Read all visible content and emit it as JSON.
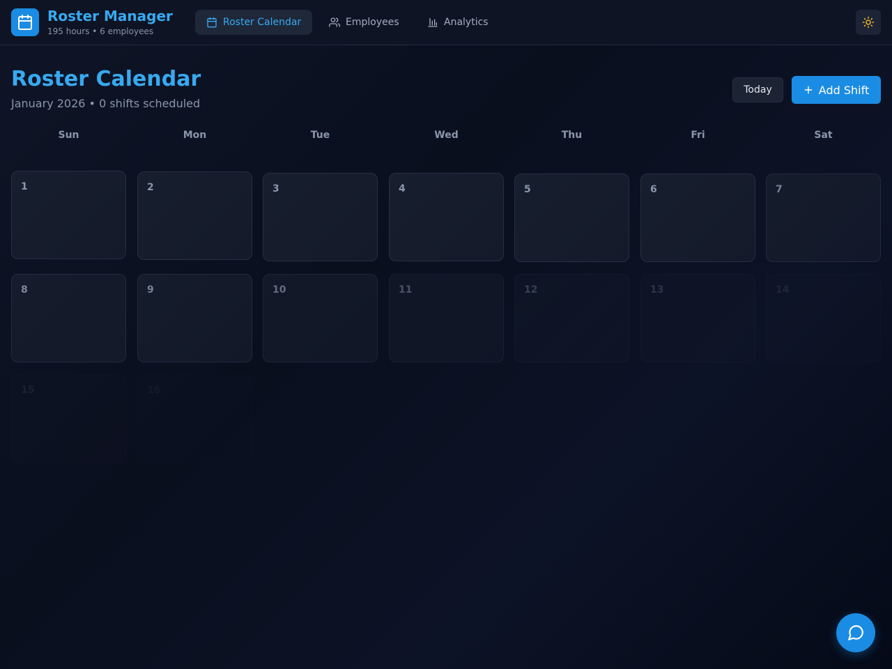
{
  "app": {
    "title": "Roster Manager",
    "subtitle": "195 hours • 6 employees",
    "logo_icon": "calendar-icon"
  },
  "nav": {
    "tabs": [
      {
        "label": "Roster Calendar",
        "icon": "calendar-icon",
        "active": true
      },
      {
        "label": "Employees",
        "icon": "users-icon",
        "active": false
      },
      {
        "label": "Analytics",
        "icon": "bar-chart-icon",
        "active": false
      }
    ],
    "theme_icon": "sun-icon"
  },
  "page": {
    "title": "Roster Calendar",
    "subtitle": "January 2026 • 0 shifts scheduled",
    "today_label": "Today",
    "add_shift_label": "Add Shift"
  },
  "calendar": {
    "weekdays": [
      "Sun",
      "Mon",
      "Tue",
      "Wed",
      "Thu",
      "Fri",
      "Sat"
    ],
    "days": [
      "1",
      "2",
      "3",
      "4",
      "5",
      "6",
      "7",
      "8",
      "9",
      "10",
      "11",
      "12",
      "13",
      "14",
      "15",
      "16"
    ]
  },
  "colors": {
    "accent": "#38a9f0",
    "primary_button": "#1b8ce3",
    "sun": "#f5b82e"
  },
  "chat": {
    "icon": "message-circle-icon"
  }
}
